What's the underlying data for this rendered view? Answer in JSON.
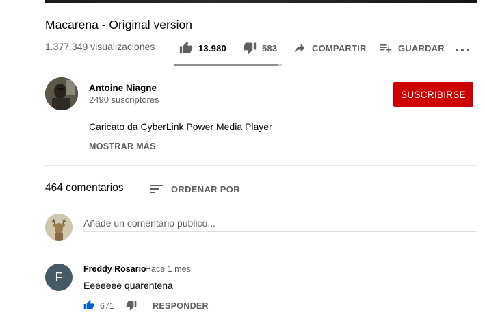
{
  "video": {
    "title": "Macarena - Original version",
    "views": "1.377.349 visualizaciones"
  },
  "actions": {
    "like_count": "13.980",
    "dislike_count": "583",
    "share_label": "COMPARTIR",
    "save_label": "GUARDAR",
    "like_ratio": 0.96
  },
  "channel": {
    "name": "Antoine Niagne",
    "subscribers": "2490 suscriptores",
    "subscribe_label": "SUSCRIBIRSE",
    "description": "Caricato da CyberLink Power Media Player",
    "show_more_label": "MOSTRAR MÁS"
  },
  "comments": {
    "count_label": "464 comentarios",
    "sort_label": "ORDENAR POR",
    "add_placeholder": "Añade un comentario público...",
    "items": [
      {
        "avatar_letter": "F",
        "author": "Freddy Rosario",
        "time": "Hace 1 mes",
        "text": "Eeeeeee quarentena",
        "likes": "671",
        "reply_label": "RESPONDER"
      }
    ]
  },
  "colors": {
    "subscribe": "#cc0000",
    "like_active": "#065fd4",
    "comment_avatar": "#455a64"
  },
  "icons": [
    "thumb-up-icon",
    "thumb-down-icon",
    "share-icon",
    "playlist-add-icon",
    "more-icon",
    "sort-icon"
  ]
}
